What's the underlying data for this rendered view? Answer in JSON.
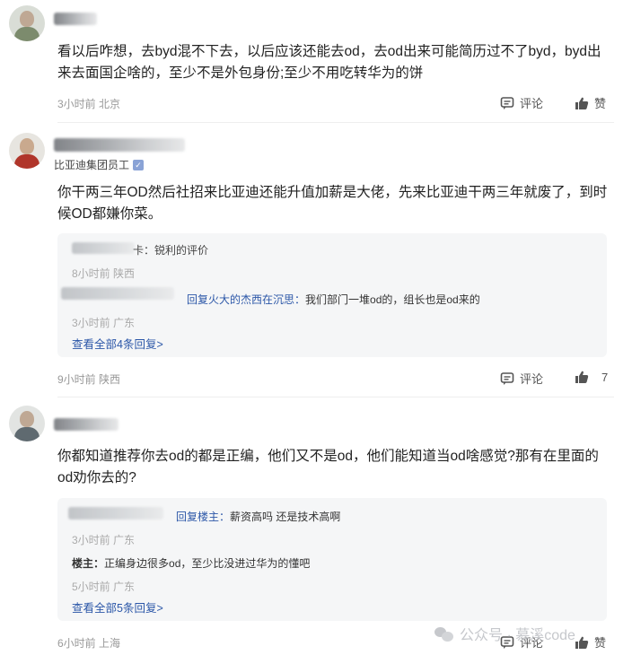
{
  "comments": [
    {
      "text": "看以后咋想，去byd混不下去，以后应该还能去od，去od出来可能简历过不了byd，byd出来去面国企啥的，至少不是外包身份;至少不用吃转华为的饼",
      "meta": "3小时前 北京",
      "comment_label": "评论",
      "like_label": "赞"
    },
    {
      "badge": "比亚迪集团员工",
      "text": "你干两三年OD然后社招来比亚迪还能升值加薪是大佬，先来比亚迪干两三年就废了，到时候OD都嫌你菜。",
      "replies": [
        {
          "suffix": "卡：锐利的评价",
          "meta": "8小时前 陕西"
        },
        {
          "reply_to": "回复火大的杰西在沉思：",
          "content": "我们部门一堆od的，组长也是od来的",
          "meta": "3小时前 广东"
        }
      ],
      "view_all": "查看全部4条回复>",
      "meta": "9小时前 陕西",
      "comment_label": "评论",
      "like_count": "7"
    },
    {
      "text": "你都知道推荐你去od的都是正编，他们又不是od，他们能知道当od啥感觉?那有在里面的od劝你去的?",
      "replies": [
        {
          "reply_to": "回复楼主：",
          "content": "薪资高吗 还是技术高啊",
          "meta": "3小时前 广东"
        },
        {
          "author": "楼主：",
          "content": "正编身边很多od，至少比没进过华为的懂吧",
          "meta": "5小时前 广东"
        }
      ],
      "view_all": "查看全部5条回复>",
      "meta": "6小时前 上海",
      "comment_label": "评论",
      "like_label": "赞"
    }
  ],
  "watermark": "公众号 · 慕溪code"
}
